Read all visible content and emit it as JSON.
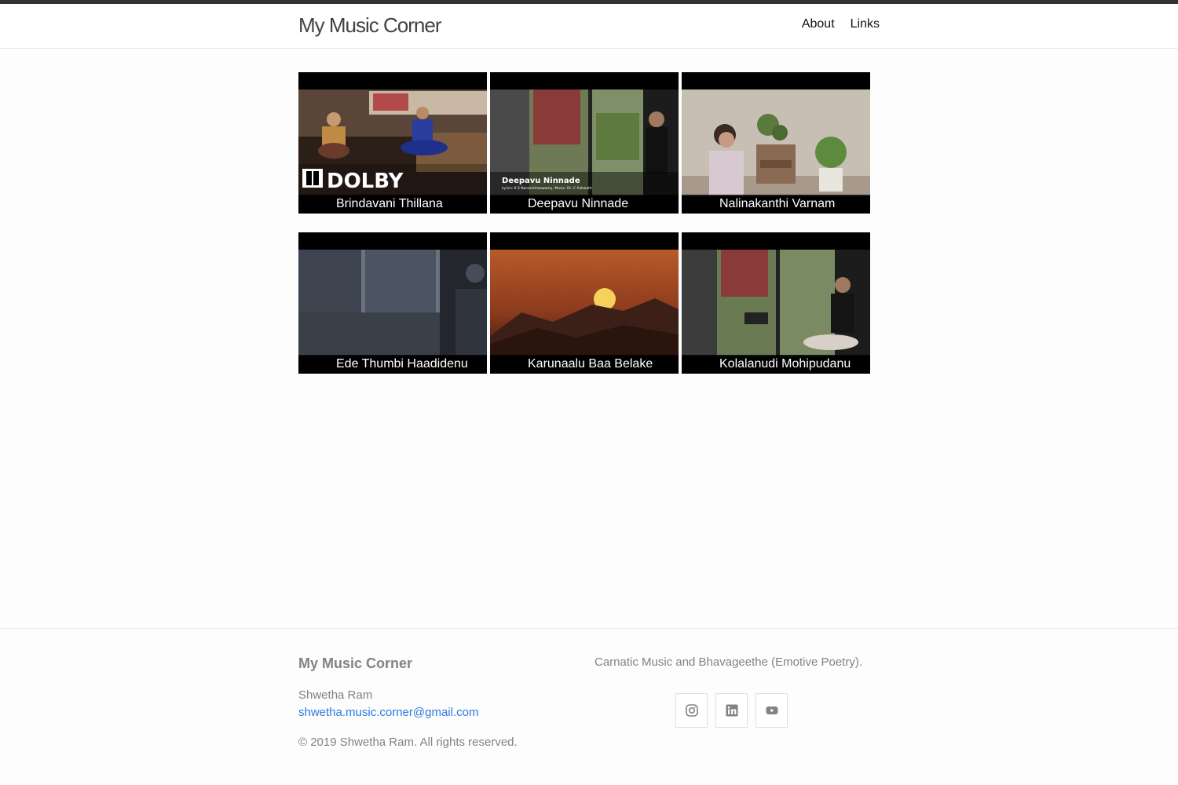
{
  "header": {
    "site_title": "My Music Corner",
    "nav": [
      {
        "label": "About"
      },
      {
        "label": "Links"
      }
    ]
  },
  "videos": [
    {
      "title": "Brindavani Thillana",
      "overlay_text": "DOLBY"
    },
    {
      "title": "Deepavu Ninnade",
      "overlay_text": "Deepavu Ninnade",
      "overlay_subtext": "Lyrics: K S Narasimhaswamy, Music: Dr. C Ashwath"
    },
    {
      "title": "Nalinakanthi Varnam"
    },
    {
      "title": "Ede Thumbi Haadidenu"
    },
    {
      "title": "Karunaalu Baa Belake"
    },
    {
      "title": "Kolalanudi Mohipudanu"
    }
  ],
  "footer": {
    "heading": "My Music Corner",
    "name": "Shwetha Ram",
    "email": "shwetha.music.corner@gmail.com",
    "copyright": "© 2019 Shwetha Ram. All rights reserved.",
    "description": "Carnatic Music and Bhavageethe (Emotive Poetry).",
    "social": [
      {
        "icon": "instagram-icon"
      },
      {
        "icon": "linkedin-icon"
      },
      {
        "icon": "youtube-icon"
      }
    ]
  },
  "colors": {
    "link": "#2a7ae2",
    "muted_text": "#828282",
    "top_strip": "#333333"
  }
}
